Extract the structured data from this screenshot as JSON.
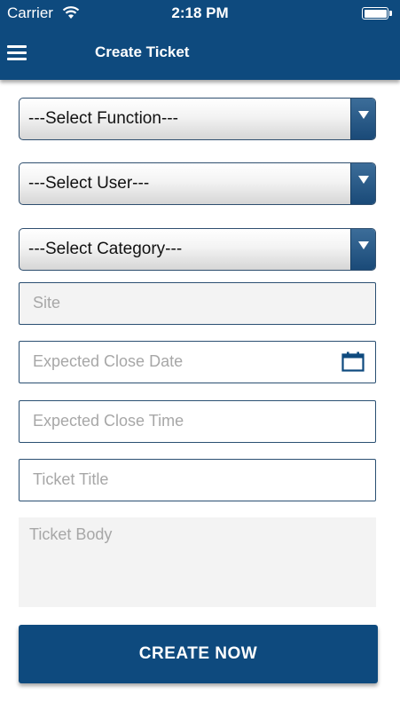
{
  "status_bar": {
    "carrier": "Carrier",
    "time": "2:18 PM",
    "battery_level": 1.0
  },
  "header": {
    "title": "Create Ticket",
    "menu_icon": "hamburger-icon"
  },
  "form": {
    "function_select": {
      "value": "---Select Function---"
    },
    "user_select": {
      "value": "---Select User---"
    },
    "category_select": {
      "value": "---Select Category---"
    },
    "site": {
      "placeholder": "Site"
    },
    "close_date": {
      "placeholder": "Expected Close Date",
      "icon": "calendar-icon"
    },
    "close_time": {
      "placeholder": "Expected Close Time"
    },
    "ticket_title": {
      "placeholder": "Ticket Title"
    },
    "ticket_body": {
      "placeholder": "Ticket Body"
    },
    "submit_label": "CREATE NOW"
  },
  "colors": {
    "primary": "#0e4a7e",
    "field_border": "#2a4f72",
    "placeholder": "#a7a7a7"
  }
}
